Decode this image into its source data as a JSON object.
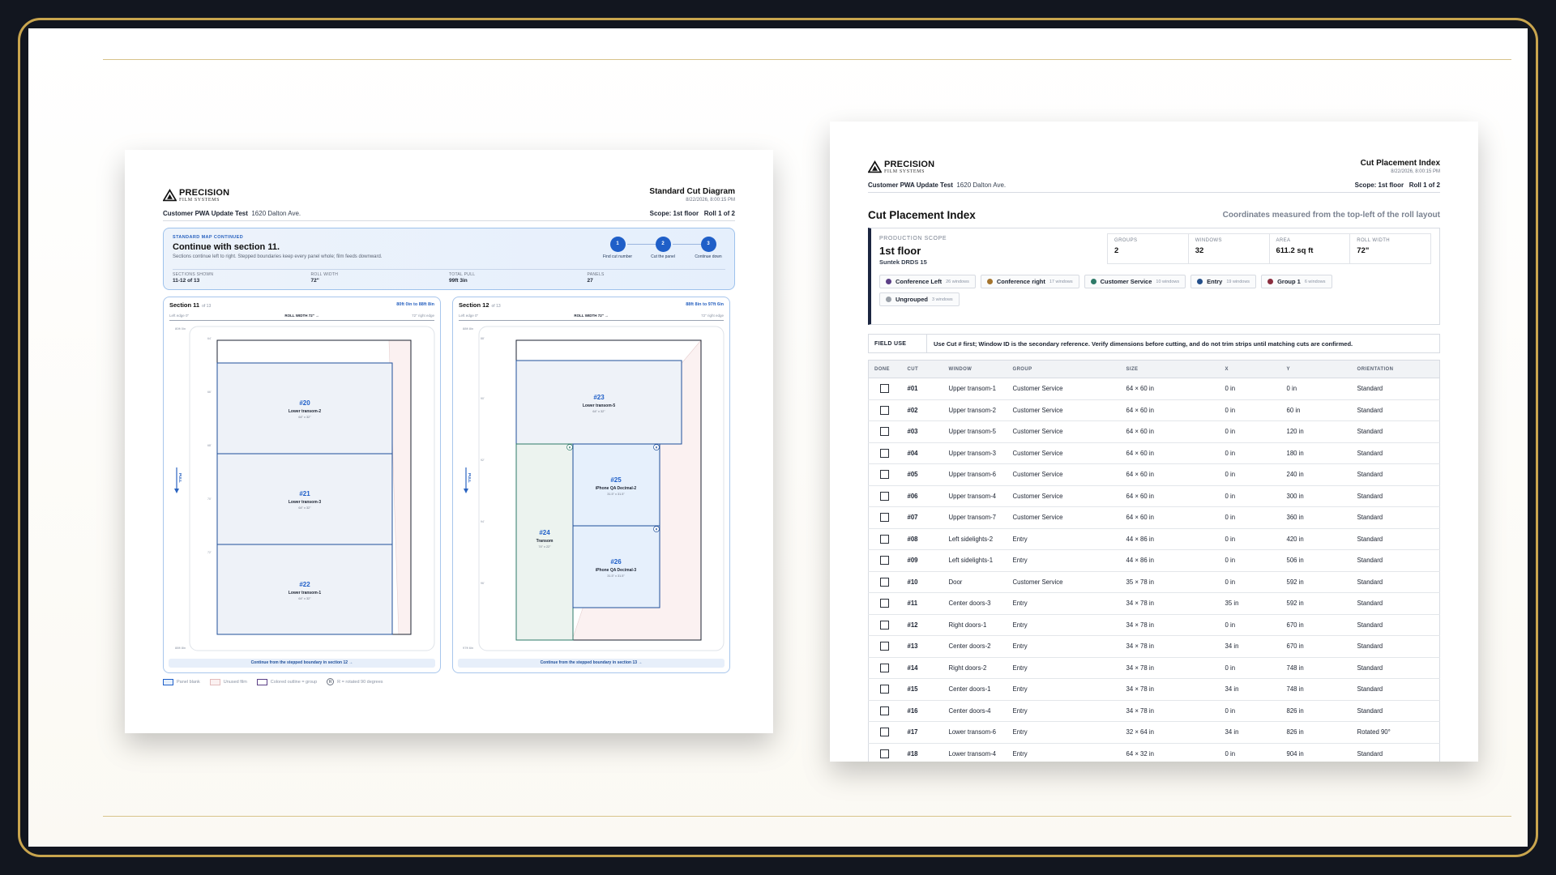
{
  "brand": {
    "name": "PRECISION",
    "tagline": "FILM SYSTEMS"
  },
  "diagram_page": {
    "title": "Standard Cut Diagram",
    "date": "8/22/2026, 8:00:15 PM",
    "customer": "Customer PWA Update Test",
    "address": "1620 Dalton Ave.",
    "scope": "Scope: 1st floor",
    "roll": "Roll 1 of 2",
    "banner": {
      "eyebrow": "STANDARD MAP CONTINUED",
      "title": "Continue with section 11.",
      "subtitle": "Sections continue left to right. Stepped boundaries keep every panel whole; film feeds downward.",
      "stats": [
        {
          "label": "SECTIONS SHOWN",
          "value": "11-12 of 13"
        },
        {
          "label": "ROLL WIDTH",
          "value": "72\""
        },
        {
          "label": "TOTAL PULL",
          "value": "99ft 3in"
        },
        {
          "label": "PANELS",
          "value": "27"
        }
      ],
      "steps": [
        {
          "num": "1",
          "label": "Find cut number"
        },
        {
          "num": "2",
          "label": "Cut the panel"
        },
        {
          "num": "3",
          "label": "Continue down"
        }
      ]
    },
    "sections": [
      {
        "title": "Section 11",
        "of": "of 13",
        "range": "80ft 0in to 88ft 8in",
        "left_edge": "Left edge 0\"",
        "roll_width": "ROLL WIDTH 72\" →",
        "right_edge": "72\" right edge",
        "top_tick": "80ft 0in",
        "bottom_tick": "88ft 8in",
        "pull": "PULL",
        "footer": "Continue from the stepped boundary in section 12 →",
        "panels": [
          {
            "id": "#20",
            "name": "Lower transom-2",
            "size": "64\" x 32\""
          },
          {
            "id": "#21",
            "name": "Lower transom-3",
            "size": "64\" x 32\""
          },
          {
            "id": "#22",
            "name": "Lower transom-1",
            "size": "64\" x 32\""
          }
        ]
      },
      {
        "title": "Section 12",
        "of": "of 13",
        "range": "88ft 8in to 97ft 6in",
        "left_edge": "Left edge 0\"",
        "roll_width": "ROLL WIDTH 72\" →",
        "right_edge": "72\" right edge",
        "top_tick": "88ft 8in",
        "bottom_tick": "97ft 6in",
        "pull": "PULL",
        "footer": "Continue from the stepped boundary in section 13 →",
        "panels": [
          {
            "id": "#23",
            "name": "Lower transom-5",
            "size": "64\" x 32\""
          },
          {
            "id": "#24",
            "name": "Transom",
            "size": "74\" x 22\""
          },
          {
            "id": "#25",
            "name": "iPhone QA Decimal-2",
            "size": "31.5\" x 31.5\""
          },
          {
            "id": "#26",
            "name": "iPhone QA Decimal-3",
            "size": "31.5\" x 31.5\""
          }
        ]
      }
    ],
    "legend": [
      {
        "label": "Panel blank"
      },
      {
        "label": "Unused film"
      },
      {
        "label": "Colored outline = group"
      },
      {
        "label": "R = rotated 90 degrees"
      }
    ]
  },
  "index_page": {
    "title": "Cut Placement Index",
    "date": "8/22/2026, 8:00:15 PM",
    "customer": "Customer PWA Update Test",
    "address": "1620 Dalton Ave.",
    "scope": "Scope: 1st floor",
    "roll": "Roll 1 of 2",
    "heading": "Cut Placement Index",
    "note": "Coordinates measured from the top-left of the roll layout",
    "production": {
      "eyebrow": "PRODUCTION SCOPE",
      "title": "1st floor",
      "film": "Suntek DRDS 15",
      "stats": [
        {
          "label": "GROUPS",
          "value": "2"
        },
        {
          "label": "WINDOWS",
          "value": "32"
        },
        {
          "label": "AREA",
          "value": "611.2 sq ft"
        },
        {
          "label": "ROLL WIDTH",
          "value": "72\""
        }
      ],
      "groups": [
        {
          "name": "Conference Left",
          "count": "26 windows",
          "color": "#5b3f86"
        },
        {
          "name": "Conference right",
          "count": "17 windows",
          "color": "#a4742d"
        },
        {
          "name": "Customer Service",
          "count": "10 windows",
          "color": "#2e7a68"
        },
        {
          "name": "Entry",
          "count": "19 windows",
          "color": "#234e8a"
        },
        {
          "name": "Group 1",
          "count": "6 windows",
          "color": "#8a2d3e"
        },
        {
          "name": "Ungrouped",
          "count": "3 windows",
          "color": "#9aa0a8"
        }
      ]
    },
    "field_use": {
      "label": "FIELD USE",
      "text": "Use Cut # first; Window ID is the secondary reference. Verify dimensions before cutting, and do not trim strips until matching cuts are confirmed."
    },
    "columns": [
      "DONE",
      "CUT",
      "WINDOW",
      "GROUP",
      "SIZE",
      "X",
      "Y",
      "ORIENTATION"
    ],
    "rows": [
      {
        "cut": "#01",
        "window": "Upper transom-1",
        "group": "Customer Service",
        "size": "64 × 60 in",
        "x": "0 in",
        "y": "0 in",
        "orientation": "Standard"
      },
      {
        "cut": "#02",
        "window": "Upper transom-2",
        "group": "Customer Service",
        "size": "64 × 60 in",
        "x": "0 in",
        "y": "60 in",
        "orientation": "Standard"
      },
      {
        "cut": "#03",
        "window": "Upper transom-5",
        "group": "Customer Service",
        "size": "64 × 60 in",
        "x": "0 in",
        "y": "120 in",
        "orientation": "Standard"
      },
      {
        "cut": "#04",
        "window": "Upper transom-3",
        "group": "Customer Service",
        "size": "64 × 60 in",
        "x": "0 in",
        "y": "180 in",
        "orientation": "Standard"
      },
      {
        "cut": "#05",
        "window": "Upper transom-6",
        "group": "Customer Service",
        "size": "64 × 60 in",
        "x": "0 in",
        "y": "240 in",
        "orientation": "Standard"
      },
      {
        "cut": "#06",
        "window": "Upper transom-4",
        "group": "Customer Service",
        "size": "64 × 60 in",
        "x": "0 in",
        "y": "300 in",
        "orientation": "Standard"
      },
      {
        "cut": "#07",
        "window": "Upper transom-7",
        "group": "Customer Service",
        "size": "64 × 60 in",
        "x": "0 in",
        "y": "360 in",
        "orientation": "Standard"
      },
      {
        "cut": "#08",
        "window": "Left sidelights-2",
        "group": "Entry",
        "size": "44 × 86 in",
        "x": "0 in",
        "y": "420 in",
        "orientation": "Standard"
      },
      {
        "cut": "#09",
        "window": "Left sidelights-1",
        "group": "Entry",
        "size": "44 × 86 in",
        "x": "0 in",
        "y": "506 in",
        "orientation": "Standard"
      },
      {
        "cut": "#10",
        "window": "Door",
        "group": "Customer Service",
        "size": "35 × 78 in",
        "x": "0 in",
        "y": "592 in",
        "orientation": "Standard"
      },
      {
        "cut": "#11",
        "window": "Center doors-3",
        "group": "Entry",
        "size": "34 × 78 in",
        "x": "35 in",
        "y": "592 in",
        "orientation": "Standard"
      },
      {
        "cut": "#12",
        "window": "Right doors-1",
        "group": "Entry",
        "size": "34 × 78 in",
        "x": "0 in",
        "y": "670 in",
        "orientation": "Standard"
      },
      {
        "cut": "#13",
        "window": "Center doors-2",
        "group": "Entry",
        "size": "34 × 78 in",
        "x": "34 in",
        "y": "670 in",
        "orientation": "Standard"
      },
      {
        "cut": "#14",
        "window": "Right doors-2",
        "group": "Entry",
        "size": "34 × 78 in",
        "x": "0 in",
        "y": "748 in",
        "orientation": "Standard"
      },
      {
        "cut": "#15",
        "window": "Center doors-1",
        "group": "Entry",
        "size": "34 × 78 in",
        "x": "34 in",
        "y": "748 in",
        "orientation": "Standard"
      },
      {
        "cut": "#16",
        "window": "Center doors-4",
        "group": "Entry",
        "size": "34 × 78 in",
        "x": "0 in",
        "y": "826 in",
        "orientation": "Standard"
      },
      {
        "cut": "#17",
        "window": "Lower transom-6",
        "group": "Entry",
        "size": "32 × 64 in",
        "x": "34 in",
        "y": "826 in",
        "orientation": "Rotated 90°"
      },
      {
        "cut": "#18",
        "window": "Lower transom-4",
        "group": "Entry",
        "size": "64 × 32 in",
        "x": "0 in",
        "y": "904 in",
        "orientation": "Standard"
      }
    ]
  }
}
